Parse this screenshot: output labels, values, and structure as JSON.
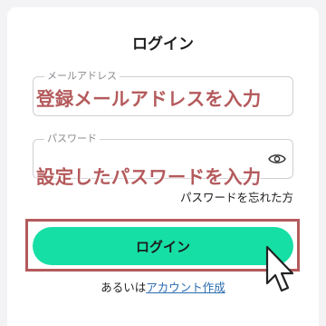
{
  "login": {
    "title": "ログイン",
    "email_label": "メールアドレス",
    "password_label": "パスワード",
    "email_hint": "登録メールアドレスを入力",
    "password_hint": "設定したパスワードを入力",
    "forgot_password": "パスワードを忘れた方",
    "login_button": "ログイン",
    "signup_prefix": "あるいは",
    "signup_link": "アカウント作成"
  },
  "icons": {
    "password_toggle": "eye-icon",
    "pointer": "mouse-cursor-icon"
  },
  "colors": {
    "primary_button": "#16dfa5",
    "annotation": "#b45a5c",
    "link": "#2b6cb0"
  }
}
